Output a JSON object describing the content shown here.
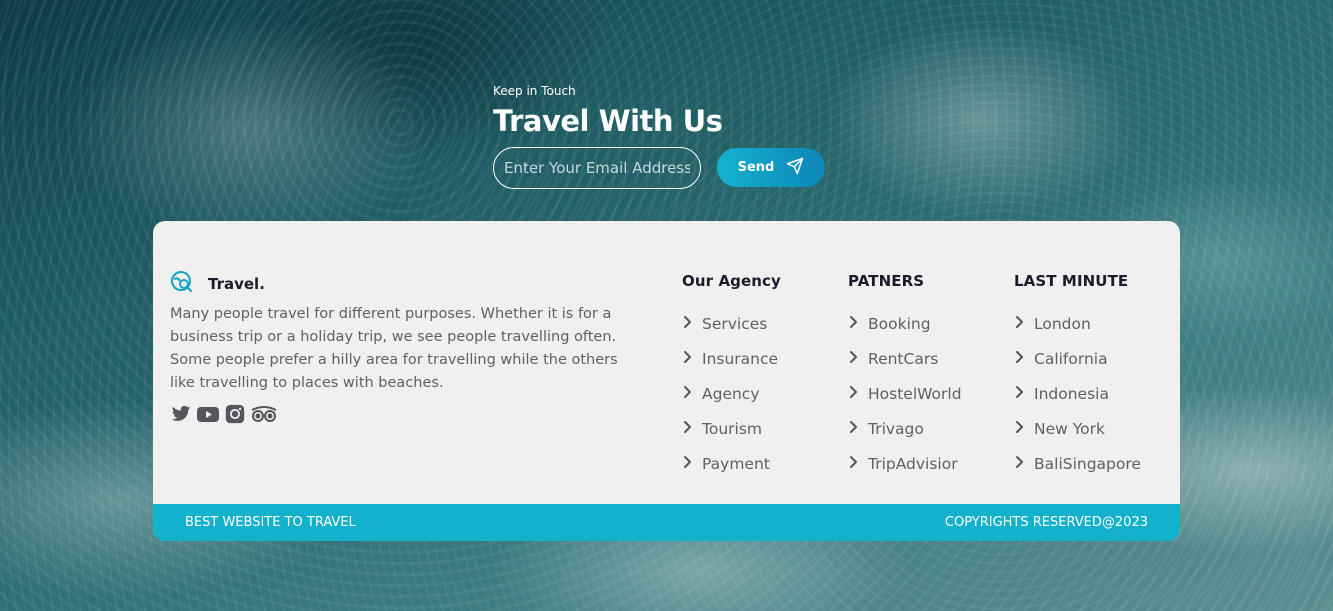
{
  "newsletter": {
    "eyebrow": "Keep in Touch",
    "title": "Travel With Us",
    "email_placeholder": "Enter Your Email Address",
    "send_label": "Send"
  },
  "footer": {
    "brand": "Travel.",
    "description": "Many people travel for different purposes. Whether it is for a business trip or a holiday trip, we see people travelling often. Some people prefer a hilly area for travelling while the others like travelling to places with beaches.",
    "social_icons": [
      "twitter-icon",
      "youtube-icon",
      "instagram-icon",
      "tripadvisor-icon"
    ],
    "columns": [
      {
        "title": "Our Agency",
        "items": [
          "Services",
          "Insurance",
          "Agency",
          "Tourism",
          "Payment"
        ]
      },
      {
        "title": "PATNERS",
        "items": [
          "Booking",
          "RentCars",
          "HostelWorld",
          "Trivago",
          "TripAdvisior"
        ]
      },
      {
        "title": "LAST MINUTE",
        "items": [
          "London",
          "California",
          "Indonesia",
          "New York",
          "BaliSingapore"
        ]
      }
    ],
    "bottom_left": "BEST WEBSITE TO TRAVEL",
    "bottom_right": "COPYRIGHTS RESERVED@2023"
  },
  "colors": {
    "accent": "#14b1cc",
    "card": "#f0f0f0",
    "heading": "#1b1b2b",
    "text": "#606066"
  }
}
